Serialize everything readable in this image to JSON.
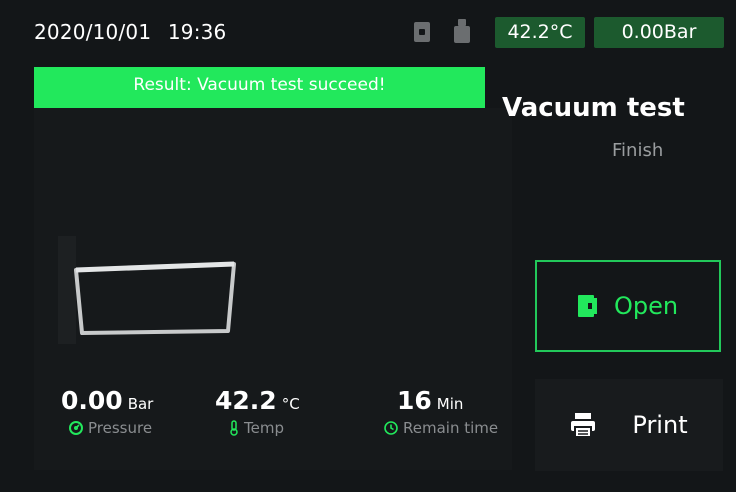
{
  "header": {
    "date": "2020/10/01",
    "time": "19:36",
    "temperature": "42.2°C",
    "pressure": "0.00Bar",
    "status_icons": [
      "door-icon",
      "usb-icon"
    ]
  },
  "result_banner": "Result: Vacuum test succeed!",
  "test": {
    "title": "Vacuum test",
    "status": "Finish"
  },
  "readings": {
    "pressure": {
      "value": "0.00",
      "unit": "Bar",
      "label": "Pressure",
      "icon": "gauge-icon"
    },
    "temp": {
      "value": "42.2",
      "unit": "°C",
      "label": "Temp",
      "icon": "thermometer-icon"
    },
    "remain_time": {
      "value": "16",
      "unit": "Min",
      "label": "Remain time",
      "icon": "clock-icon"
    }
  },
  "buttons": {
    "open": "Open",
    "print": "Print"
  },
  "colors": {
    "accent_green": "#22e85c",
    "badge_green": "#1c5a2e",
    "background": "#131618",
    "muted_text": "#8a8d90"
  }
}
